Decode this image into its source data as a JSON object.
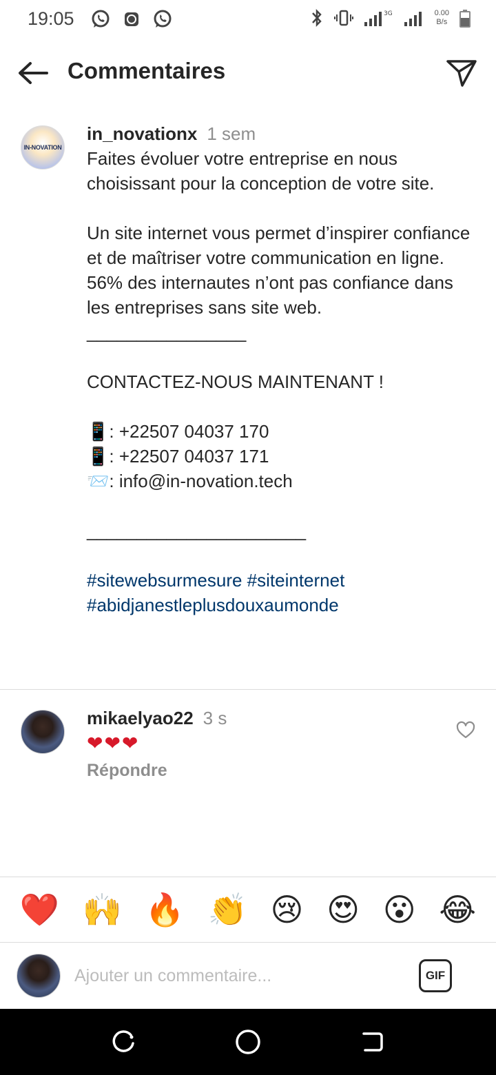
{
  "status_bar": {
    "time": "19:05",
    "left_icons": [
      "whatsapp-icon",
      "app-icon",
      "whatsapp-icon"
    ],
    "right_icons": [
      "bluetooth-icon",
      "vibrate-icon",
      "signal-icon",
      "signal-3g-icon",
      "battery-icon"
    ],
    "net_speed_value": "0.00",
    "net_speed_unit": "B/s"
  },
  "header": {
    "title": "Commentaires",
    "back_icon": "arrow-left-icon",
    "share_icon": "paper-plane-icon"
  },
  "caption": {
    "avatar_text": "IN-NOVATION",
    "username": "in_novationx",
    "time": "1 sem",
    "paragraphs": [
      "Faites évoluer votre entreprise en nous choisissant pour la conception de votre site.",
      " Un site internet vous permet d’inspirer confiance et de maîtriser votre communication en ligne. 56% des internautes n’ont pas confiance dans les entreprises sans site web.",
      "________________",
      "CONTACTEZ-NOUS MAINTENANT !",
      "📱: +22507 04037 170\n📱: +22507 04037 171\n📨: info@in-novation.tech",
      "______________________"
    ],
    "hashtags": [
      "#sitewebsurmesure",
      "#siteinternet",
      "#abidjanestleplusdouxaumonde"
    ]
  },
  "comment": {
    "username": "mikaelyao22",
    "time": "3 s",
    "text": "❤❤❤",
    "reply_label": "Répondre",
    "like_icon": "heart-outline-icon"
  },
  "emoji_bar": [
    "❤️",
    "🙌",
    "🔥",
    "👏",
    "😢",
    "😍",
    "😮",
    "😂"
  ],
  "input": {
    "placeholder": "Ajouter un commentaire...",
    "gif_label": "GIF"
  },
  "nav": [
    "recent-apps-icon",
    "home-icon",
    "back-icon"
  ],
  "colors": {
    "text": "#262626",
    "muted": "#8e8e8e",
    "hashtag": "#00376b",
    "heart": "#d7192a",
    "divider": "#dbdbdb"
  }
}
